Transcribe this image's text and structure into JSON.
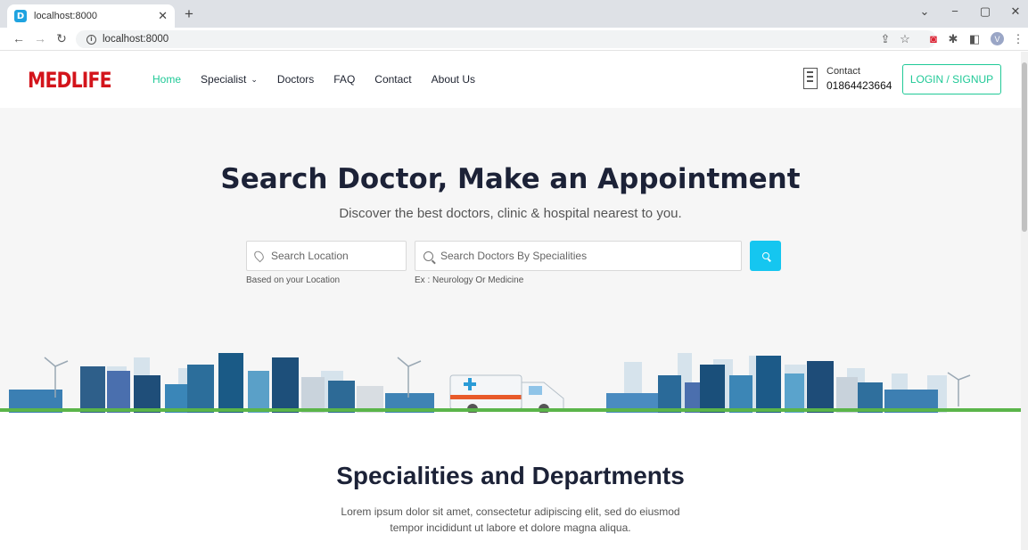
{
  "browser": {
    "tab_title": "localhost:8000",
    "favicon_letter": "D",
    "url": "localhost:8000",
    "profile_letter": "V"
  },
  "site": {
    "logo_part1": "MED",
    "logo_part2": "LIFE",
    "nav": [
      "Home",
      "Specialist",
      "Doctors",
      "FAQ",
      "Contact",
      "About Us"
    ],
    "active_nav": "Home",
    "contact_label": "Contact",
    "contact_phone": "01864423664",
    "login_label": "LOGIN / SIGNUP",
    "accent_color": "#20c997"
  },
  "hero": {
    "title": "Search Doctor, Make an Appointment",
    "subtitle": "Discover the best doctors, clinic & hospital nearest to you.",
    "location_placeholder": "Search Location",
    "location_hint": "Based on your Location",
    "specialty_placeholder": "Search Doctors By Specialities",
    "specialty_hint": "Ex : Neurology Or Medicine",
    "search_button_color": "#15c6f0"
  },
  "section": {
    "title": "Specialities and Departments",
    "text_line1": "Lorem ipsum dolor sit amet, consectetur adipiscing elit, sed do eiusmod",
    "text_line2": "tempor incididunt ut labore et dolore magna aliqua."
  }
}
